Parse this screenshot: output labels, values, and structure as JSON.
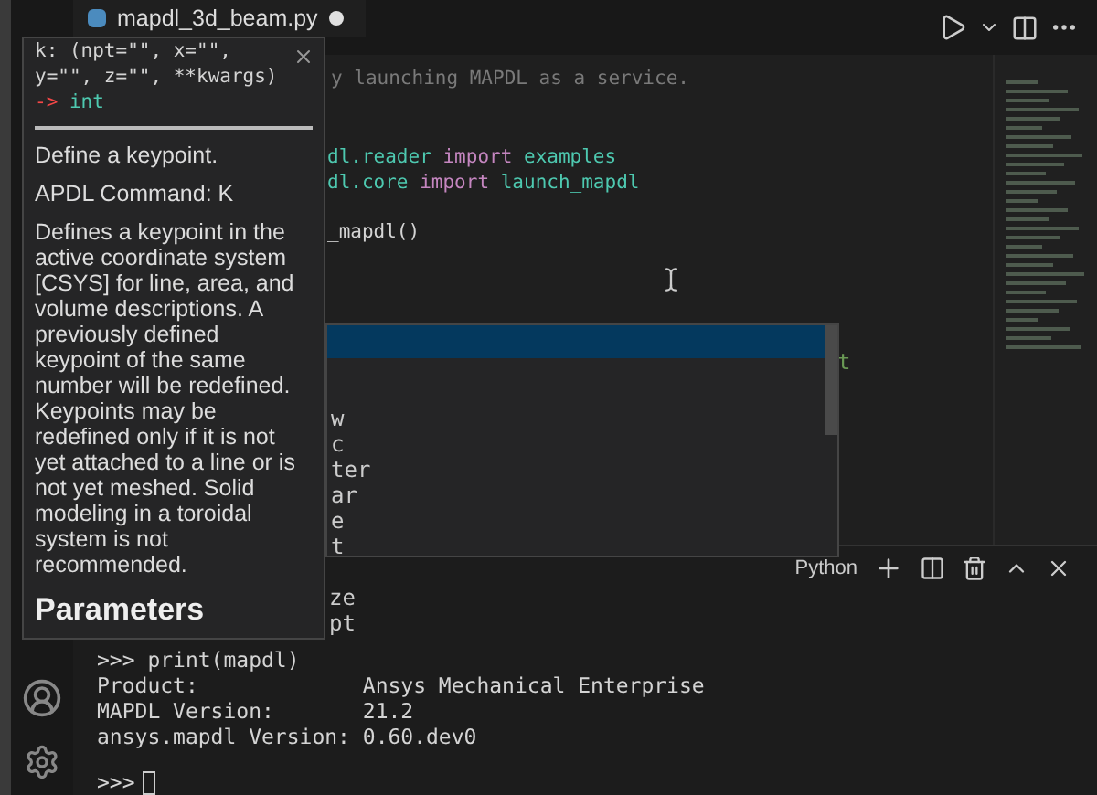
{
  "tab": {
    "title": "mapdl_3d_beam.py",
    "modified": true
  },
  "editor": {
    "comment": "y launching MAPDL as a service.",
    "lines": [
      {
        "kind": "import",
        "module": "dl.reader",
        "keyword": "import",
        "name": "examples"
      },
      {
        "kind": "import",
        "module": "dl.core",
        "keyword": "import",
        "name": "launch_mapdl"
      },
      {
        "kind": "call",
        "text": "_mapdl()"
      }
    ],
    "side_fragment": "t"
  },
  "hover": {
    "signature": "k: (npt=\"\", x=\"\", y=\"\", z=\"\", **kwargs)",
    "arrow": "->",
    "return_type": "int",
    "paragraphs": [
      "Define a keypoint.",
      "APDL Command: K",
      "Defines a keypoint in the active coordinate system [CSYS] for line, area, and volume descriptions. A previously defined keypoint of the same number will be redefined. Keypoints may be redefined only if it is not yet attached to a line or is not yet meshed. Solid modeling in a toroidal system is not recommended."
    ],
    "heading": "Parameters"
  },
  "completion": {
    "items": [
      {
        "text": "w",
        "selected": false
      },
      {
        "text": "c",
        "selected": false
      },
      {
        "text": "ter",
        "selected": false
      },
      {
        "text": "ar",
        "selected": false
      },
      {
        "text": "e",
        "selected": false
      },
      {
        "text": "t",
        "selected": false
      }
    ],
    "selected_row": true,
    "below": [
      "ze",
      "pt"
    ]
  },
  "terminal": {
    "shell": "Python",
    "lines": [
      ">>> print(mapdl)",
      "Product:             Ansys Mechanical Enterprise",
      "MAPDL Version:       21.2",
      "ansys.mapdl Version: 0.60.dev0"
    ],
    "prompt": ">>>"
  }
}
